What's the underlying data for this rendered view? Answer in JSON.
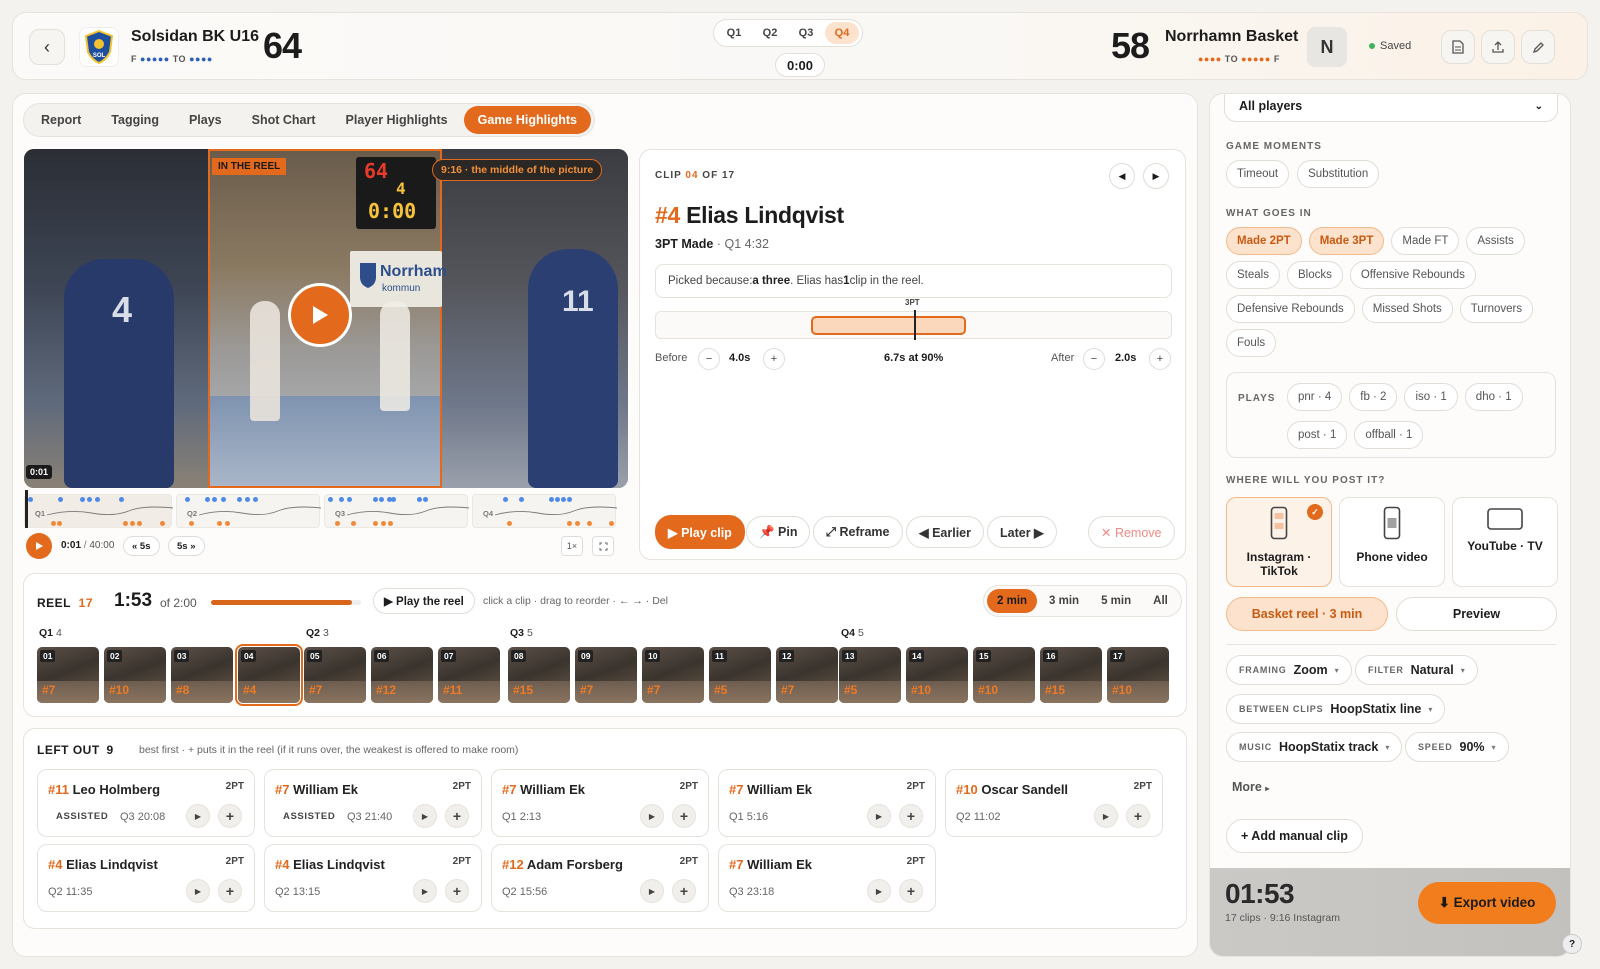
{
  "header": {
    "home": {
      "name": "Solsidan BK U16",
      "score": "64",
      "fouls_label": "F",
      "to_label": "TO",
      "logo_text": "SOL",
      "fouls_dots": "●●●●●",
      "to_dots": "●●●●"
    },
    "away": {
      "name": "Norrhamn Basket",
      "score": "58",
      "fouls_label": "F",
      "to_label": "TO",
      "logo_text": "N",
      "fouls_dots": "●●●●●",
      "to_dots": "●●●●"
    },
    "quarters": [
      "Q1",
      "Q2",
      "Q3",
      "Q4"
    ],
    "active_quarter": "Q4",
    "clock": "0:00",
    "saved_label": "Saved"
  },
  "tabs": [
    "Report",
    "Tagging",
    "Plays",
    "Shot Chart",
    "Player Highlights",
    "Game Highlights"
  ],
  "active_tab": "Game Highlights",
  "video": {
    "reel_badge": "IN THE REEL",
    "crop_badge": "9:16 · the middle of the picture",
    "scoreboard": {
      "score": "64",
      "period": "4",
      "clock": "0:00"
    },
    "banner_text": "Norrham",
    "banner_sub": "kommun",
    "jersey_left": "4",
    "jersey_right": "11",
    "time_overlay": "0:01",
    "timeline_quarters": [
      "Q1",
      "Q2",
      "Q3",
      "Q4"
    ],
    "position": "0:01",
    "duration": "40:00",
    "back_label": "« 5s",
    "fwd_label": "5s »",
    "speed": "1×"
  },
  "clip": {
    "index": "04",
    "total": "17",
    "clip_word": "CLIP",
    "of_word": "OF",
    "jersey": "#4",
    "player": "Elias Lindqvist",
    "event": "3PT Made",
    "meta": "· Q1 4:32",
    "reason_prefix": "Picked because:",
    "reason_bold": "a three",
    "reason_mid": ". Elias has",
    "reason_count": "1",
    "reason_suffix": "clip in the reel.",
    "marker_label": "3PT",
    "before_label": "Before",
    "before_value": "4.0s",
    "summary": "6.7s at 90%",
    "after_label": "After",
    "after_value": "2.0s",
    "actions": {
      "play": "▶ Play clip",
      "pin": "📌 Pin",
      "reframe": "⤢ Reframe",
      "earlier": "◀ Earlier",
      "later": "Later ▶",
      "remove": "✕ Remove"
    }
  },
  "reel": {
    "label": "REEL",
    "count": "17",
    "duration": "1:53",
    "of_label": "of 2:00",
    "progress": 0.94,
    "play_label": "▶ Play the reel",
    "hint": "click a clip · drag to reorder · ← → · Del",
    "length_options": [
      "2 min",
      "3 min",
      "5 min",
      "All"
    ],
    "active_length": "2 min",
    "groups": [
      {
        "label": "Q1",
        "count": "4",
        "clips": [
          {
            "n": "01",
            "p": "#7"
          },
          {
            "n": "02",
            "p": "#10"
          },
          {
            "n": "03",
            "p": "#8"
          },
          {
            "n": "04",
            "p": "#4"
          }
        ]
      },
      {
        "label": "Q2",
        "count": "3",
        "clips": [
          {
            "n": "05",
            "p": "#7"
          },
          {
            "n": "06",
            "p": "#12"
          },
          {
            "n": "07",
            "p": "#11"
          }
        ]
      },
      {
        "label": "Q3",
        "count": "5",
        "clips": [
          {
            "n": "08",
            "p": "#15"
          },
          {
            "n": "09",
            "p": "#7"
          },
          {
            "n": "10",
            "p": "#7"
          },
          {
            "n": "11",
            "p": "#5"
          },
          {
            "n": "12",
            "p": "#7"
          }
        ]
      },
      {
        "label": "Q4",
        "count": "5",
        "clips": [
          {
            "n": "13",
            "p": "#5"
          },
          {
            "n": "14",
            "p": "#10"
          },
          {
            "n": "15",
            "p": "#10"
          },
          {
            "n": "16",
            "p": "#15"
          },
          {
            "n": "17",
            "p": "#10"
          }
        ]
      }
    ]
  },
  "left_out": {
    "label": "LEFT OUT",
    "count": "9",
    "hint": "best first · + puts it in the reel (if it runs over, the weakest is offered to make room)",
    "items": [
      {
        "jersey": "#11",
        "name": "Leo Holmberg",
        "type": "2PT",
        "assisted": "ASSISTED",
        "time": "Q3 20:08"
      },
      {
        "jersey": "#7",
        "name": "William Ek",
        "type": "2PT",
        "assisted": "ASSISTED",
        "time": "Q3 21:40"
      },
      {
        "jersey": "#7",
        "name": "William Ek",
        "type": "2PT",
        "assisted": "",
        "time": "Q1 2:13"
      },
      {
        "jersey": "#7",
        "name": "William Ek",
        "type": "2PT",
        "assisted": "",
        "time": "Q1 5:16"
      },
      {
        "jersey": "#10",
        "name": "Oscar Sandell",
        "type": "2PT",
        "assisted": "",
        "time": "Q2 11:02"
      },
      {
        "jersey": "#4",
        "name": "Elias Lindqvist",
        "type": "2PT",
        "assisted": "",
        "time": "Q2 11:35"
      },
      {
        "jersey": "#4",
        "name": "Elias Lindqvist",
        "type": "2PT",
        "assisted": "",
        "time": "Q2 13:15"
      },
      {
        "jersey": "#12",
        "name": "Adam Forsberg",
        "type": "2PT",
        "assisted": "",
        "time": "Q2 15:56"
      },
      {
        "jersey": "#7",
        "name": "William Ek",
        "type": "2PT",
        "assisted": "",
        "time": "Q3 23:18"
      }
    ]
  },
  "sidebar": {
    "player_filter": "All players",
    "moments_label": "GAME MOMENTS",
    "moments": [
      "Timeout",
      "Substitution"
    ],
    "goes_in_label": "WHAT GOES IN",
    "goes_in": [
      {
        "label": "Made 2PT",
        "on": true
      },
      {
        "label": "Made 3PT",
        "on": true
      },
      {
        "label": "Made FT",
        "on": false
      },
      {
        "label": "Assists",
        "on": false
      },
      {
        "label": "Steals",
        "on": false
      },
      {
        "label": "Blocks",
        "on": false
      },
      {
        "label": "Offensive Rebounds",
        "on": false
      },
      {
        "label": "Defensive Rebounds",
        "on": false
      },
      {
        "label": "Missed Shots",
        "on": false
      },
      {
        "label": "Turnovers",
        "on": false
      },
      {
        "label": "Fouls",
        "on": false
      }
    ],
    "plays_label": "PLAYS",
    "plays": [
      "pnr · 4",
      "fb · 2",
      "iso · 1",
      "dho · 1",
      "post · 1",
      "offball · 1"
    ],
    "post_label": "WHERE WILL YOU POST IT?",
    "formats": [
      {
        "label": "Instagram · TikTok",
        "selected": true
      },
      {
        "label": "Phone video",
        "selected": false
      },
      {
        "label": "YouTube · TV",
        "selected": false
      }
    ],
    "preset_label": "Basket reel · 3 min",
    "preview_label": "Preview",
    "framing_key": "FRAMING",
    "framing_val": "Zoom",
    "filter_key": "FILTER",
    "filter_val": "Natural",
    "between_key": "BETWEEN CLIPS",
    "between_val": "HoopStatix line",
    "music_key": "MUSIC",
    "music_val": "HoopStatix track",
    "speed_key": "SPEED",
    "speed_val": "90%",
    "more_label": "More",
    "add_manual": "+ Add manual clip",
    "total_time": "01:53",
    "total_meta": "17 clips · 9:16 Instagram",
    "export_label": "⬇ Export video",
    "help": "?"
  },
  "colors": {
    "accent": "#e36a1c",
    "accent_soft": "#fde3cd",
    "blue_dot": "#4e8ae8"
  }
}
